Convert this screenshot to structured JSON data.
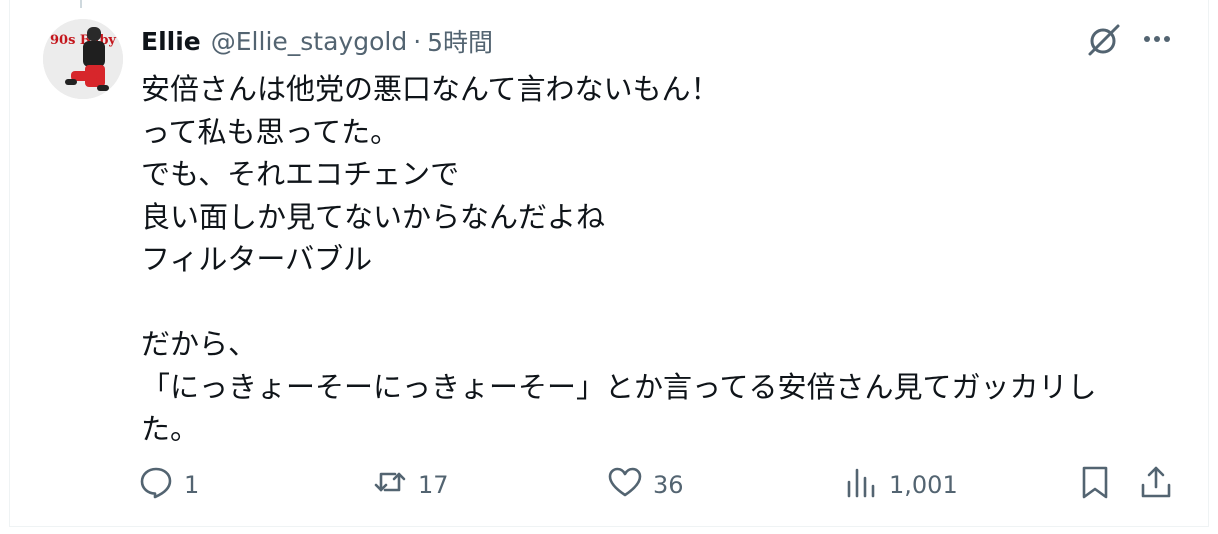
{
  "tweet": {
    "author_name": "Ellie",
    "author_handle": "@Ellie_staygold",
    "separator": "·",
    "time_ago": "5時間",
    "avatar_text": "90s Baby",
    "body_lines": [
      "安倍さんは他党の悪口なんて言わないもん！",
      "って私も思ってた。",
      "でも、それエコチェンで",
      "良い面しか見てないからなんだよね",
      "フィルターバブル",
      "",
      "だから、",
      "「にっきょーそーにっきょーそー」とか言ってる安倍さん見てガッカリし",
      "た。"
    ]
  },
  "actions": {
    "reply_count": "1",
    "repost_count": "17",
    "like_count": "36",
    "views_count": "1,001"
  },
  "colors": {
    "text_primary": "#0f1419",
    "text_secondary": "#536471",
    "border": "#eff3f4"
  },
  "icons": [
    "grok-icon",
    "more-icon",
    "reply-icon",
    "repost-icon",
    "like-icon",
    "views-icon",
    "bookmark-icon",
    "share-icon"
  ]
}
